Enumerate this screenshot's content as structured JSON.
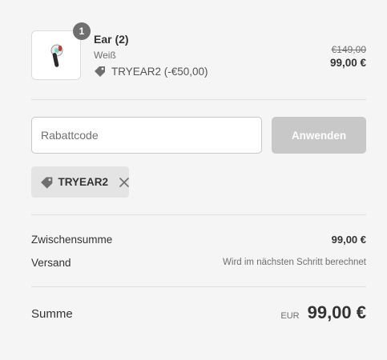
{
  "cart": {
    "item": {
      "quantity": "1",
      "name": "Ear (2)",
      "variant": "Weiß",
      "discount_line": "TRYEAR2 (-€50,00)",
      "original_price": "€149,00",
      "price": "99,00 €"
    }
  },
  "discount": {
    "placeholder": "Rabattcode",
    "apply_label": "Anwenden",
    "applied_code": "TRYEAR2"
  },
  "summary": {
    "subtotal_label": "Zwischensumme",
    "subtotal_value": "99,00 €",
    "shipping_label": "Versand",
    "shipping_value": "Wird im nächsten Schritt berechnet",
    "total_label": "Summe",
    "currency": "EUR",
    "total_value": "99,00 €"
  },
  "colors": {
    "background": "#f5f5f5",
    "badge": "#6f6f6f",
    "button_disabled": "#c8c8c8",
    "chip": "#e4e4e4"
  },
  "icons": [
    "earbud-product-image",
    "tag-icon",
    "close-icon"
  ]
}
